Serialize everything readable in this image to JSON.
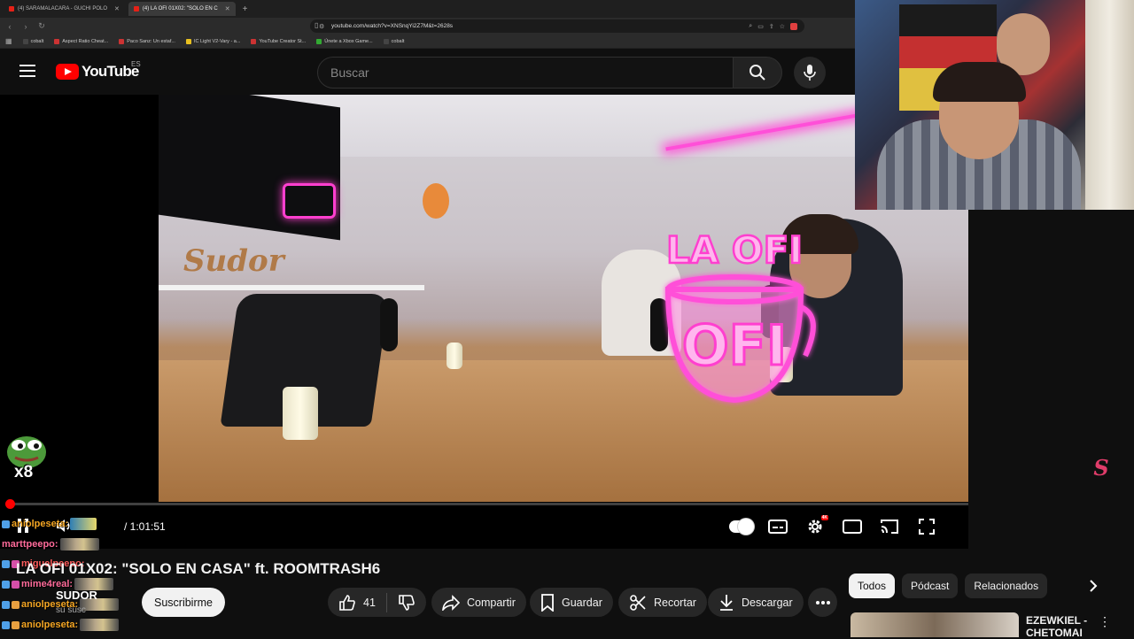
{
  "browser": {
    "tabs": [
      {
        "label": "(4) SARAMALACARA - GUCHI POLO",
        "active": false
      },
      {
        "label": "(4) LA OFI 01X02: \"SOLO EN C",
        "active": true
      }
    ],
    "url": "youtube.com/watch?v=XNSnqYi2Z7M&t=2628s",
    "bookmarks": [
      "cobalt",
      "Aspect Ratio Cheat...",
      "Paco Sanz: Un estaf...",
      "IC Light V2-Vary - a...",
      "YouTube Creator St...",
      "Únete a Xbox Game...",
      "cobalt"
    ]
  },
  "youtube": {
    "logo_text": "YouTube",
    "country_code": "ES",
    "search_placeholder": "Buscar"
  },
  "player": {
    "time_display": "/ 1:01:51",
    "progress_fraction": 0.0,
    "scene_neon_text": "LA OFI"
  },
  "video": {
    "title": "LA OFI 01X02: \"SOLO EN CASA\" ft. ROOMTRASH6",
    "channel_name": "SUDOR",
    "channel_subs": "su susc",
    "subscribe_label": "Suscribirme",
    "like_count": "41",
    "share_label": "Compartir",
    "save_label": "Guardar",
    "clip_label": "Recortar",
    "download_label": "Descargar"
  },
  "sidebar": {
    "chips": [
      {
        "label": "Todos",
        "active": true
      },
      {
        "label": "Pódcast",
        "active": false
      },
      {
        "label": "Relacionados",
        "active": false
      }
    ],
    "recommendation_title": "EZEWKIEL - CHETOMAI"
  },
  "stream_overlay": {
    "emote_counter": "x8",
    "chat": [
      {
        "user": "aniolpeseta:",
        "color": "#f5a623"
      },
      {
        "user": "marttpeepo:",
        "color": "#ff6b9a"
      },
      {
        "user": "miguelpeepo:",
        "color": "#ff5c5c"
      },
      {
        "user": "mime4real:",
        "color": "#ff6b9a"
      },
      {
        "user": "aniolpeseta:",
        "color": "#f5a623"
      },
      {
        "user": "aniolpeseta:",
        "color": "#f5a623"
      }
    ]
  },
  "colors": {
    "yt_red": "#ff0000",
    "background": "#0f0f0f",
    "pill_bg": "#272727",
    "neon_pink": "#ff3fcf"
  }
}
